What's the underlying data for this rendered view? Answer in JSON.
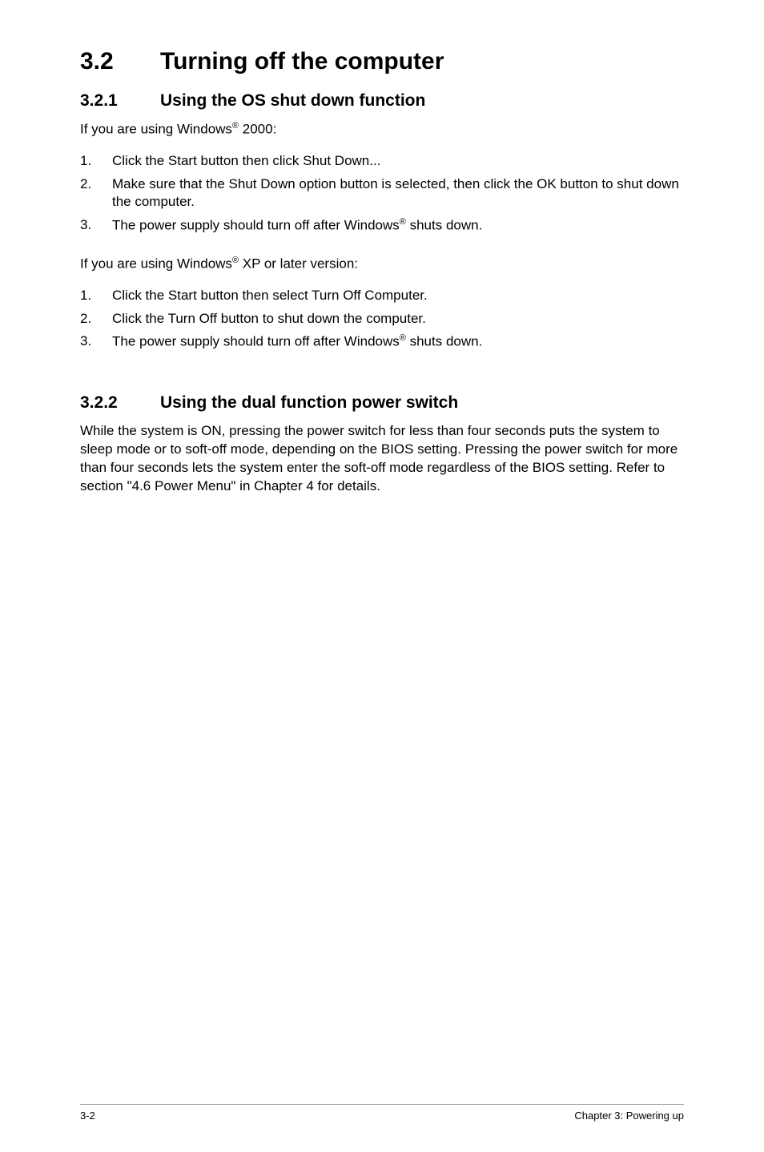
{
  "section": {
    "number": "3.2",
    "title": "Turning off the computer"
  },
  "sub1": {
    "number": "3.2.1",
    "title": "Using the OS shut down function",
    "intro1_pre": "If you are using Windows",
    "intro1_post": " 2000:",
    "list1": [
      {
        "n": "1.",
        "text": "Click the Start button then click Shut Down..."
      },
      {
        "n": "2.",
        "text": "Make sure that the Shut Down option button is selected, then click the OK button to shut down the computer."
      },
      {
        "n": "3.",
        "text_pre": "The power supply should turn off after Windows",
        "text_post": " shuts down."
      }
    ],
    "intro2_pre": "If you are using Windows",
    "intro2_post": " XP or later version:",
    "list2": [
      {
        "n": "1.",
        "text": "Click the Start button then select Turn Off Computer."
      },
      {
        "n": "2.",
        "text": "Click the Turn Off button to shut down the computer."
      },
      {
        "n": "3.",
        "text_pre": "The power supply should turn off after Windows",
        "text_post": " shuts down."
      }
    ]
  },
  "sub2": {
    "number": "3.2.2",
    "title": "Using the dual function power switch",
    "paragraph": "While the system is ON, pressing the power switch for less than four seconds puts the system to sleep mode or to soft-off mode, depending on the BIOS setting. Pressing the power switch for more than four seconds lets the system enter the soft-off mode regardless of the BIOS setting. Refer to section  \"4.6 Power Menu\" in Chapter 4 for details."
  },
  "footer": {
    "left": "3-2",
    "right": "Chapter 3: Powering up"
  },
  "registered": "®"
}
